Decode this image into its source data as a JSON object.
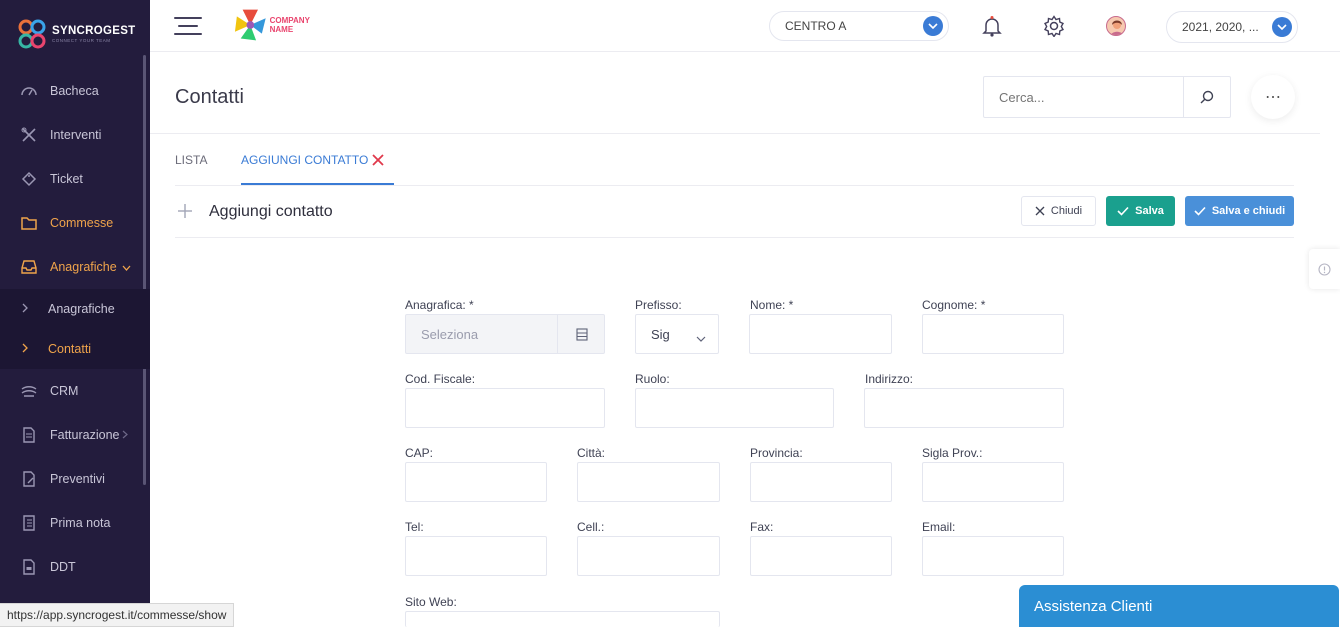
{
  "brand": {
    "name": "SYNCROGEST",
    "tagline": "CONNECT YOUR TEAM"
  },
  "topbar": {
    "company": "COMPANY NAME",
    "centro": "CENTRO A",
    "years": "2021, 2020, ..."
  },
  "sidebar": {
    "items": [
      {
        "label": "Bacheca",
        "icon": "dashboard-icon"
      },
      {
        "label": "Interventi",
        "icon": "tools-icon"
      },
      {
        "label": "Ticket",
        "icon": "ticket-icon"
      },
      {
        "label": "Commesse",
        "icon": "folder-icon"
      },
      {
        "label": "Anagrafiche",
        "icon": "inbox-icon"
      },
      {
        "label": "Anagrafiche",
        "icon": "chevron-right-icon"
      },
      {
        "label": "Contatti",
        "icon": "chevron-right-icon"
      },
      {
        "label": "CRM",
        "icon": "handshake-icon"
      },
      {
        "label": "Fatturazione",
        "icon": "invoice-icon"
      },
      {
        "label": "Preventivi",
        "icon": "quote-icon"
      },
      {
        "label": "Prima nota",
        "icon": "ledger-icon"
      },
      {
        "label": "DDT",
        "icon": "ddt-icon"
      }
    ]
  },
  "page": {
    "title": "Contatti",
    "search_placeholder": "Cerca...",
    "more_label": "⋯"
  },
  "tabs": {
    "lista": "LISTA",
    "aggiungi": "AGGIUNGI CONTATTO"
  },
  "card": {
    "title": "Aggiungi contatto",
    "chiudi": "Chiudi",
    "salva": "Salva",
    "salva_chiudi": "Salva e chiudi"
  },
  "form": {
    "anagrafica": {
      "label": "Anagrafica: *",
      "placeholder": "Seleziona"
    },
    "prefisso": {
      "label": "Prefisso:",
      "value": "Sig"
    },
    "nome": {
      "label": "Nome: *"
    },
    "cognome": {
      "label": "Cognome: *"
    },
    "cod_fiscale": {
      "label": "Cod. Fiscale:"
    },
    "ruolo": {
      "label": "Ruolo:"
    },
    "indirizzo": {
      "label": "Indirizzo:"
    },
    "cap": {
      "label": "CAP:"
    },
    "citta": {
      "label": "Città:"
    },
    "provincia": {
      "label": "Provincia:"
    },
    "sigla_prov": {
      "label": "Sigla Prov.:"
    },
    "tel": {
      "label": "Tel:"
    },
    "cell": {
      "label": "Cell.:"
    },
    "fax": {
      "label": "Fax:"
    },
    "email": {
      "label": "Email:"
    },
    "sito_web": {
      "label": "Sito Web:"
    }
  },
  "status_url": "https://app.syncrogest.it/commesse/show",
  "chat_label": "Assistenza Clienti",
  "colors": {
    "sidebar": "#231c3d",
    "accent": "#3a7bd5",
    "active": "#f0a44b",
    "success": "#1aa08e"
  }
}
